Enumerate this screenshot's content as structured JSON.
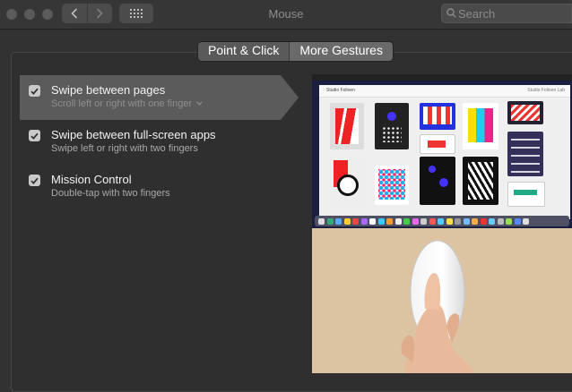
{
  "window": {
    "title": "Mouse",
    "search_placeholder": "Search"
  },
  "tabs": [
    {
      "label": "Point & Click",
      "active": true
    },
    {
      "label": "More Gestures",
      "active": false
    }
  ],
  "options": [
    {
      "title": "Swipe between pages",
      "subtitle": "Scroll left or right with one finger",
      "checked": true,
      "selected": true,
      "has_dropdown": true
    },
    {
      "title": "Swipe between full-screen apps",
      "subtitle": "Swipe left or right with two fingers",
      "checked": true,
      "selected": false
    },
    {
      "title": "Mission Control",
      "subtitle": "Double-tap with two fingers",
      "checked": true,
      "selected": false
    }
  ],
  "preview": {
    "app_title": "Studio Folioen",
    "app_right": "Studio Folioen Lab"
  },
  "colors": {
    "window_bg": "#323232",
    "selected_row": "#5b5b5b",
    "checkbox": "#c9c9c9"
  },
  "icons": [
    "back-icon",
    "forward-icon",
    "grid-icon",
    "search-icon",
    "checkmark-icon",
    "chevron-down-icon"
  ]
}
